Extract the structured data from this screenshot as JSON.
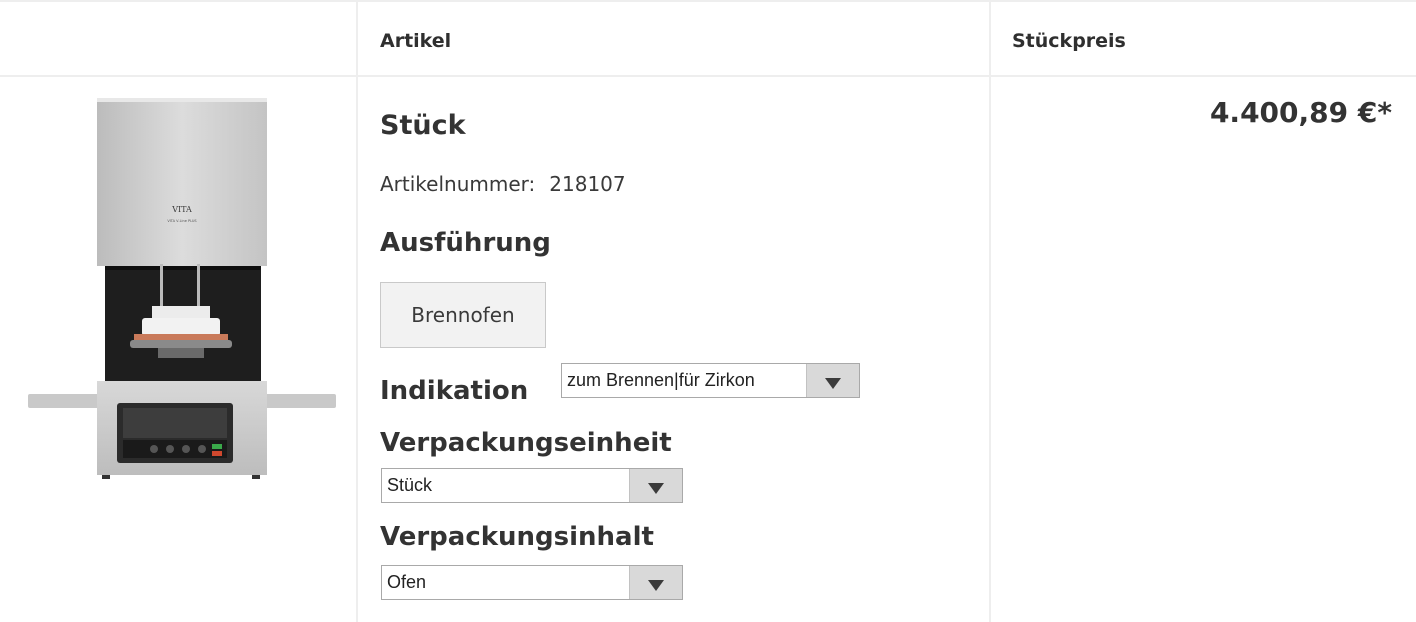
{
  "header": {
    "article_label": "Artikel",
    "unit_price_label": "Stückpreis"
  },
  "product": {
    "image_icon": "furnace-product-image",
    "image_brand": "VITA",
    "image_model": "VITA V-Line PLUS",
    "title": "Stück",
    "article_number_label": "Artikelnummer:",
    "article_number": "218107",
    "variant_title": "Ausführung",
    "variant_option": "Brennofen",
    "indication_label": "Indikation",
    "indication_value": "zum Brennen|für Zirkon",
    "packaging_unit_label": "Verpackungseinheit",
    "packaging_unit_value": "Stück",
    "packaging_content_label": "Verpackungsinhalt",
    "packaging_content_value": "Ofen",
    "price": "4.400,89 €*"
  },
  "colors": {
    "border": "#eeeeee",
    "text": "#333333",
    "button_bg": "#f2f2f2",
    "select_arrow_bg": "#d9d9d9"
  }
}
